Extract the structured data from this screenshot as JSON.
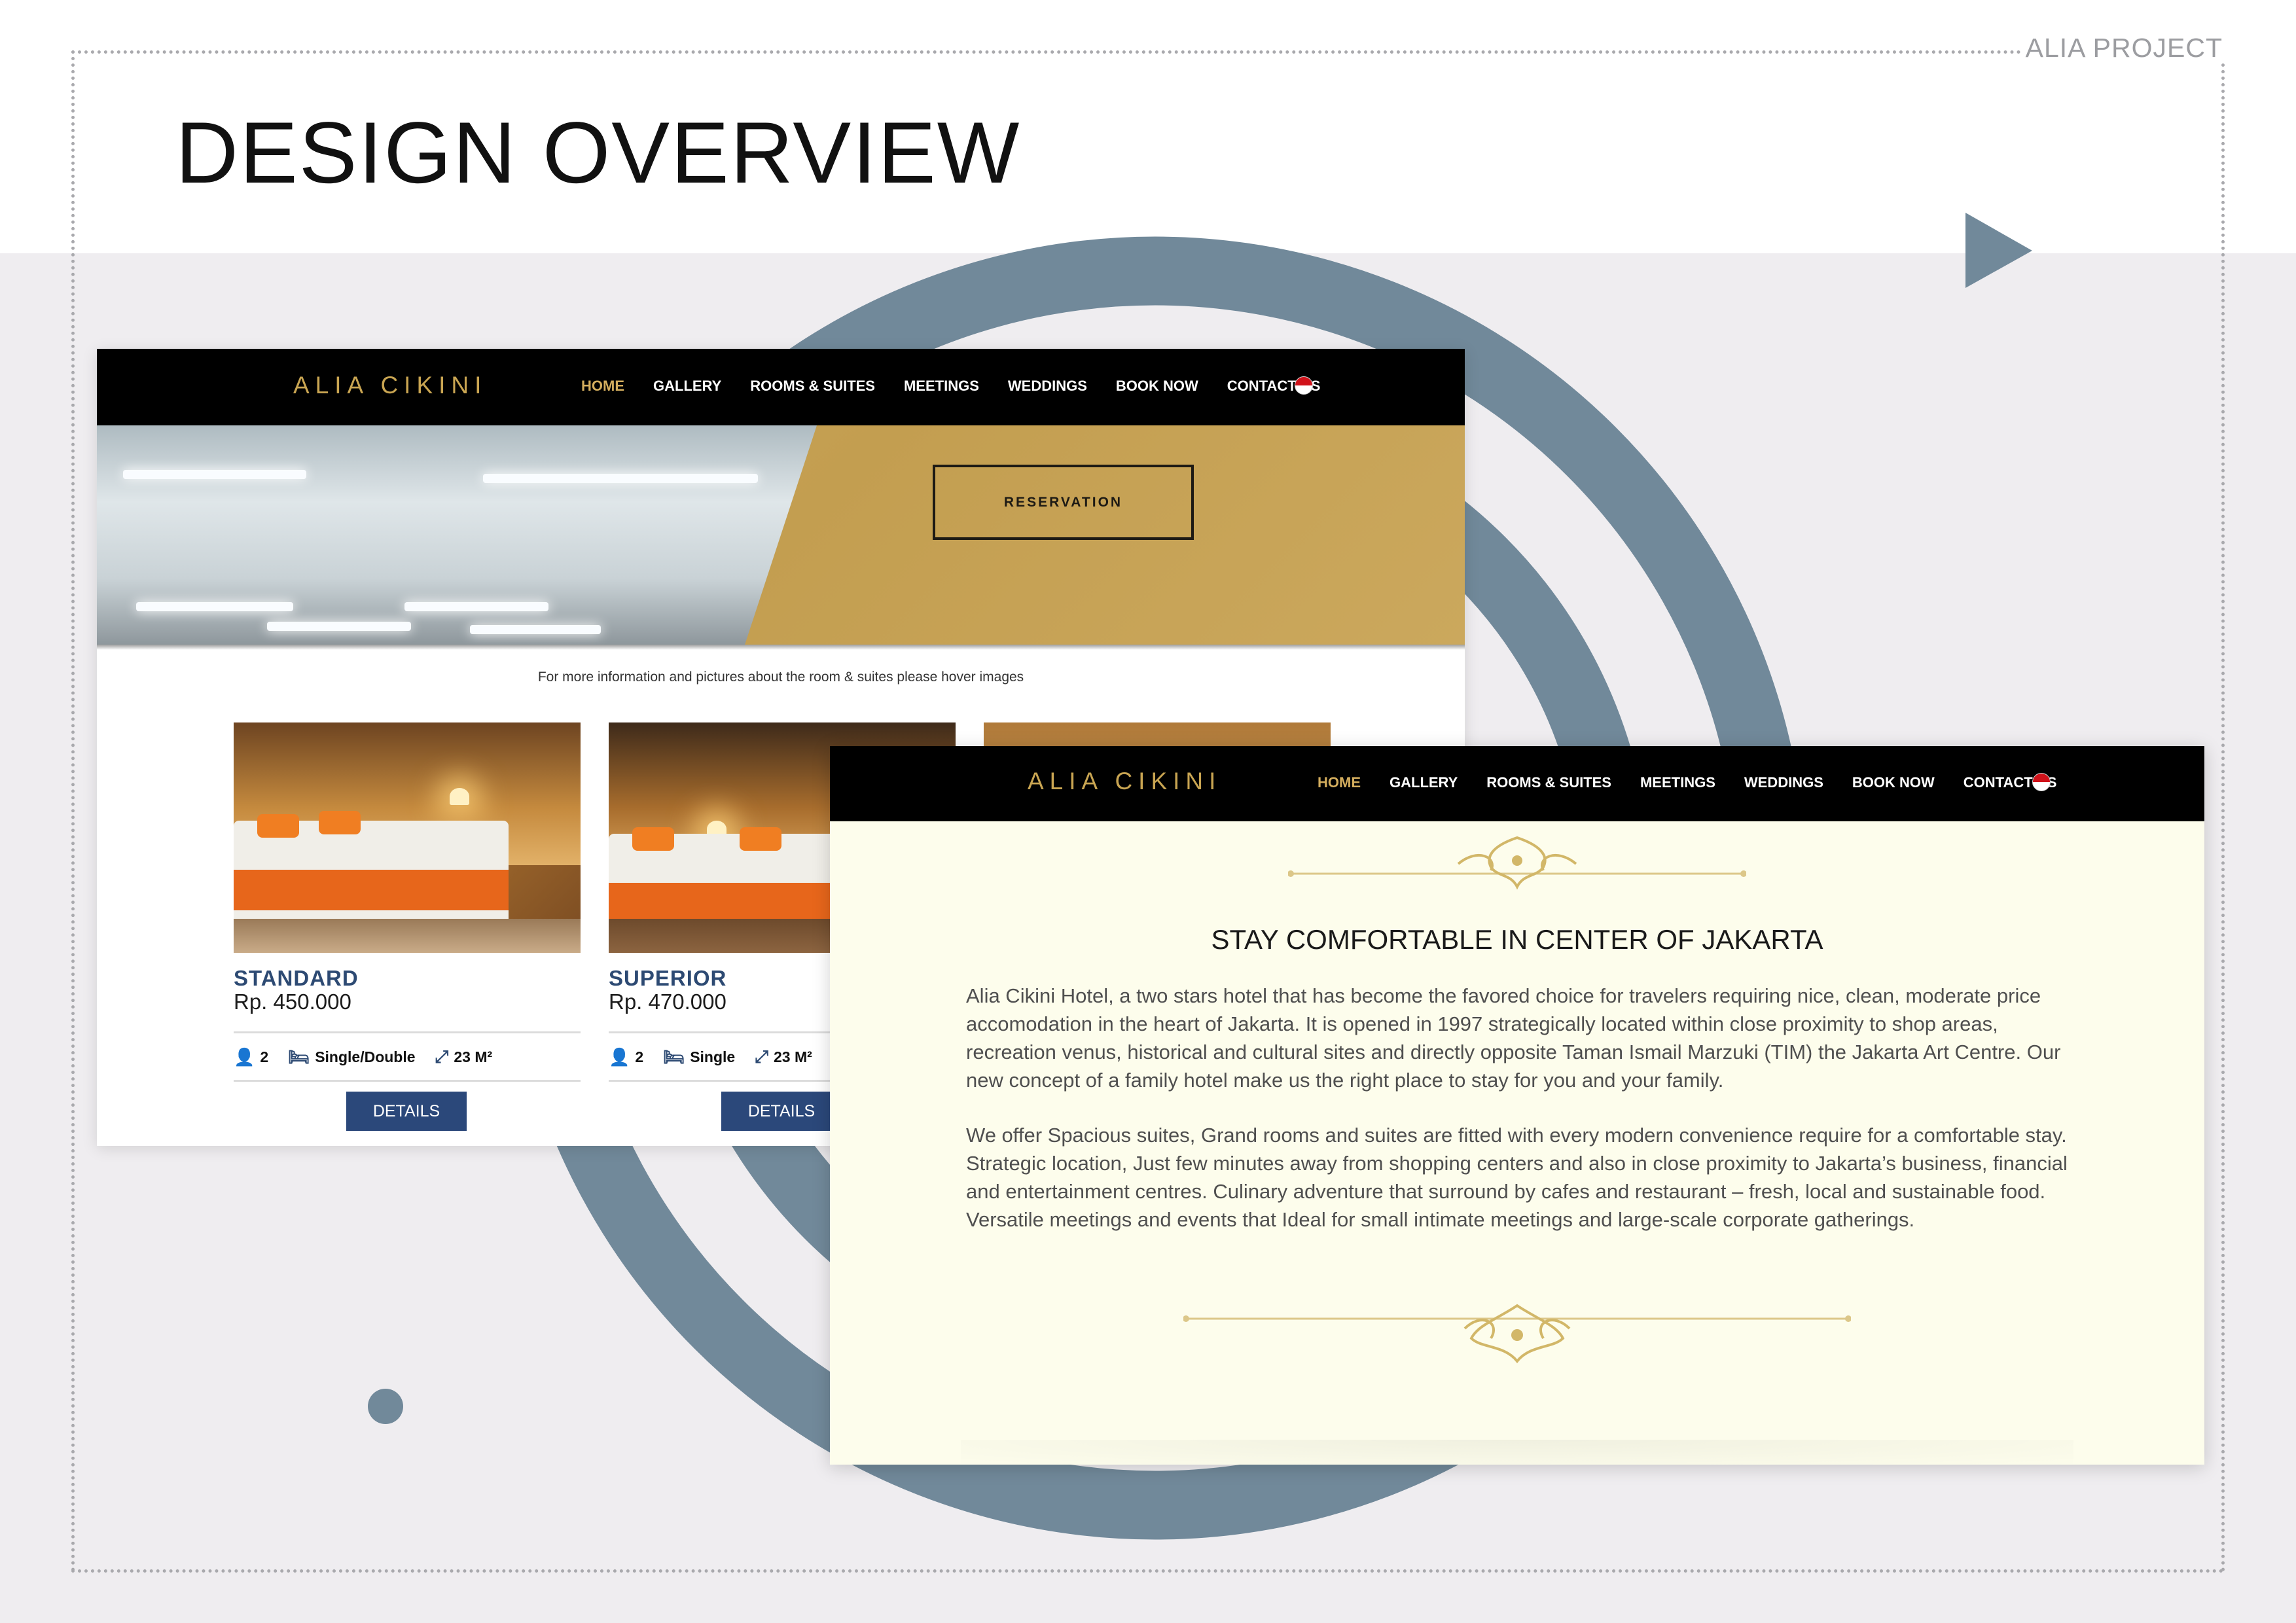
{
  "header": {
    "project_tag": "ALIA PROJECT",
    "title": "DESIGN OVERVIEW"
  },
  "colors": {
    "accent_gold": "#c9a552",
    "nav_black": "#000000",
    "button_navy": "#2b487a",
    "decor_slate": "#71899a",
    "cream_bg": "#fdfdec"
  },
  "mockup_home": {
    "logo": "ALIA CIKINI",
    "nav": [
      "HOME",
      "GALLERY",
      "ROOMS & SUITES",
      "MEETINGS",
      "WEDDINGS",
      "BOOK NOW",
      "CONTACT US"
    ],
    "active_nav": "HOME",
    "flag_icon": "indonesia-flag-icon",
    "hero_button": "RESERVATION",
    "hover_note": "For more information and pictures about the room & suites please hover images",
    "rooms": [
      {
        "name": "STANDARD",
        "price": "Rp. 450.000",
        "guests": "2",
        "bed": "Single/Double",
        "size": "23 M²",
        "button": "DETAILS"
      },
      {
        "name": "SUPERIOR",
        "price": "Rp. 470.000",
        "guests": "2",
        "bed": "Single",
        "size": "23 M²",
        "button": "DETAILS"
      }
    ]
  },
  "mockup_about": {
    "logo": "ALIA CIKINI",
    "nav": [
      "HOME",
      "GALLERY",
      "ROOMS & SUITES",
      "MEETINGS",
      "WEDDINGS",
      "BOOK NOW",
      "CONTACT US"
    ],
    "active_nav": "HOME",
    "heading": "STAY COMFORTABLE IN CENTER OF JAKARTA",
    "paragraphs": [
      "Alia Cikini Hotel, a two stars hotel that has become the favored choice for travelers requiring nice, clean, moderate price accomodation in the heart of Jakarta. It is opened in 1997 strategically located within close proximity to shop areas, recreation venus, historical and cultural sites and directly opposite Taman Ismail Marzuki (TIM) the Jakarta Art Centre. Our new concept of a family hotel make us the right place to stay for you and your family.",
      "We offer Spacious suites, Grand rooms and suites are fitted with every modern convenience require for a comfortable stay. Strategic location, Just few minutes away from shopping centers and also in close proximity to Jakarta’s business, financial and entertainment centres. Culinary adventure that surround by cafes and restaurant – fresh, local and sustainable food. Versatile meetings and events that Ideal for small intimate meetings and large-scale corporate gatherings."
    ]
  }
}
